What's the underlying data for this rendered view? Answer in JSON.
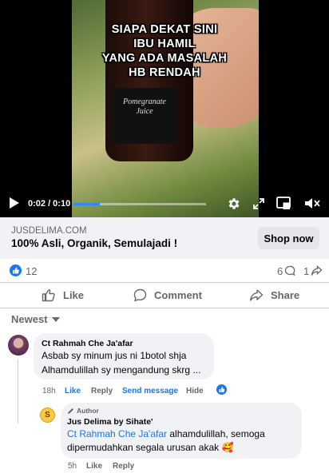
{
  "video": {
    "overlay_lines": [
      "SIAPA DEKAT SINI",
      "IBU HAMIL",
      "YANG ADA MASALAH",
      "HB RENDAH"
    ],
    "bottle_label": [
      "Pomegranate",
      "Juice"
    ],
    "time": "0:02 / 0:10",
    "progress": 0.2,
    "icons": [
      "play-icon",
      "gear-icon",
      "fullscreen-icon",
      "picture-in-picture-icon",
      "mute-icon"
    ]
  },
  "ad": {
    "domain": "JUSDELIMA.COM",
    "headline": "100% Asli, Organik, Semulajadi !",
    "cta": "Shop now"
  },
  "stats": {
    "reactions": "12",
    "comments": "6",
    "shares": "1"
  },
  "actions": {
    "like": "Like",
    "comment": "Comment",
    "share": "Share"
  },
  "sort": {
    "label": "Newest"
  },
  "comments": [
    {
      "name": "Ct Rahmah Che Ja'afar",
      "lines": [
        "Asbab sy minum jus ni 1botol shja",
        "Alhamdulillah sy mengandung skrg ..."
      ],
      "time": "18h",
      "like": "Like",
      "reply": "Reply",
      "send_message": "Send message",
      "hide": "Hide"
    }
  ],
  "reply": {
    "author_tag": "Author",
    "avatar_letter": "S",
    "name": "Jus Delima by Sihate'",
    "mention": "Ct Rahmah Che Ja'afar",
    "text_after_mention": " alhamdulillah, semoga",
    "line2": "dipermudahkan segala urusan akak 🥰",
    "time": "5h",
    "like": "Like",
    "reply": "Reply"
  },
  "colors": {
    "accent": "#1877f2",
    "muted": "#65676b",
    "bubble": "#f0f2f5"
  }
}
